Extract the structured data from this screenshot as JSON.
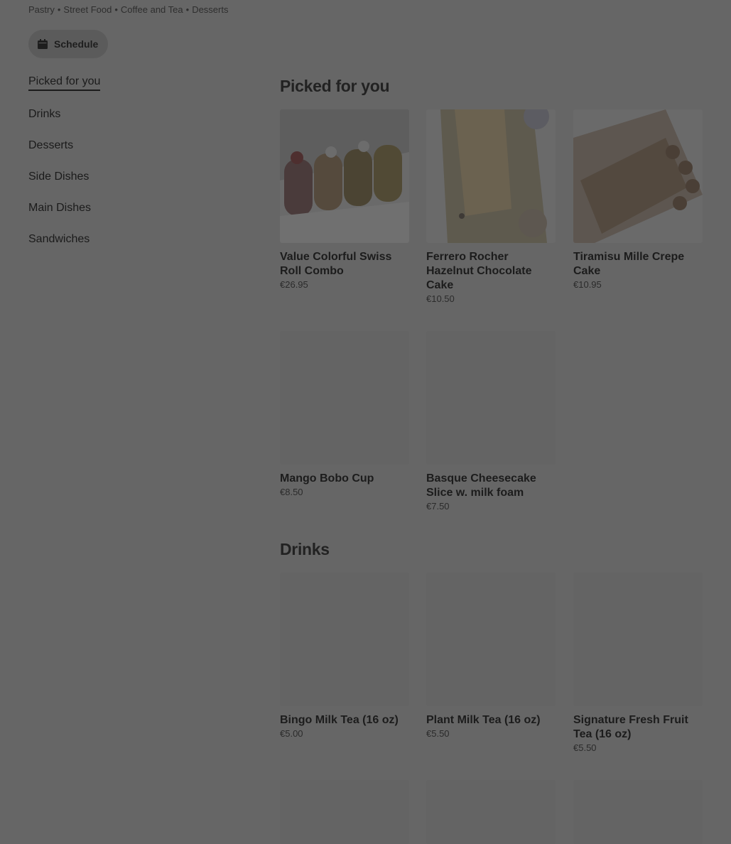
{
  "header": {
    "tags": [
      "Pastry",
      "Street Food",
      "Coffee and Tea",
      "Desserts"
    ],
    "tag_separator": "•"
  },
  "schedule_button": {
    "label": "Schedule",
    "icon": "calendar-icon"
  },
  "sidenav": {
    "items": [
      {
        "label": "Picked for you",
        "active": true
      },
      {
        "label": "Drinks"
      },
      {
        "label": "Desserts"
      },
      {
        "label": "Side Dishes"
      },
      {
        "label": "Main Dishes"
      },
      {
        "label": "Sandwiches"
      }
    ]
  },
  "sections": [
    {
      "title": "Picked for you",
      "items": [
        {
          "name": "Value Colorful Swiss Roll Combo",
          "price": "€26.95"
        },
        {
          "name": "Ferrero Rocher Hazelnut Chocolate Cake",
          "price": "€10.50"
        },
        {
          "name": "Tiramisu Mille Crepe Cake",
          "price": "€10.95"
        },
        {
          "name": "Mango Bobo Cup",
          "price": "€8.50"
        },
        {
          "name": "Basque Cheesecake Slice w. milk foam",
          "price": "€7.50"
        }
      ]
    },
    {
      "title": "Drinks",
      "items": [
        {
          "name": "Bingo Milk Tea (16 oz)",
          "price": "€5.00"
        },
        {
          "name": "Plant Milk Tea (16 oz)",
          "price": "€5.50"
        },
        {
          "name": "Signature Fresh Fruit Tea (16 oz)",
          "price": "€5.50"
        }
      ]
    }
  ]
}
